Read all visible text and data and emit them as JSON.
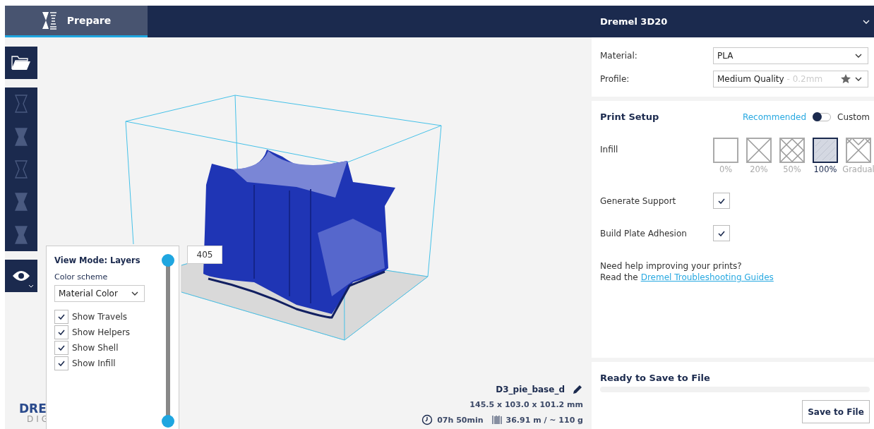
{
  "tabs": [
    {
      "label": "Prepare",
      "selected": true
    }
  ],
  "printer": {
    "name": "Dremel 3D20"
  },
  "view_popup": {
    "title": "View Mode: Layers",
    "color_scheme_label": "Color scheme",
    "color_scheme": "Material Color",
    "options": [
      {
        "label": "Show Travels",
        "checked": true
      },
      {
        "label": "Show Helpers",
        "checked": true
      },
      {
        "label": "Show Shell",
        "checked": true
      },
      {
        "label": "Show Infill",
        "checked": true
      }
    ]
  },
  "layer_slider": {
    "top_handle": {
      "level": 1,
      "reading": "405"
    },
    "bottom_handle": {
      "level": 0
    }
  },
  "logo": {
    "line_1": "DRE",
    "line_2": "DIG"
  },
  "model_info": {
    "name": "D3_pie_base_d",
    "dimensions": "145.5 x 103.0 x 101.2 mm",
    "print_time": "07h 50min",
    "material_usage": "36.91 m / ~ 110 g"
  },
  "settings": {
    "material": {
      "label": "Material:",
      "value": "PLA"
    },
    "profile": {
      "label": "Profile:",
      "value": "Medium Quality",
      "detail": "- 0.2mm"
    }
  },
  "print_setup": {
    "title": "Print Setup",
    "modes": [
      {
        "label": "Recommended",
        "selected": true
      },
      {
        "label": "Custom",
        "selected": false
      }
    ],
    "infill": {
      "label": "Infill",
      "options": [
        {
          "label": "0%",
          "kind": "empty",
          "selected": false
        },
        {
          "label": "20%",
          "kind": "sparse",
          "selected": false
        },
        {
          "label": "50%",
          "kind": "dense",
          "selected": false
        },
        {
          "label": "100%",
          "kind": "solid",
          "selected": true
        },
        {
          "label": "Gradual",
          "kind": "gradual",
          "selected": false
        }
      ]
    },
    "toggles": [
      {
        "label": "Generate Support",
        "checked": true
      },
      {
        "label": "Build Plate Adhesion",
        "checked": true
      }
    ],
    "help": {
      "text": "Need help improving your prints?",
      "link_prefix": "Read the",
      "link": "Dremel Troubleshooting Guides"
    }
  },
  "status": {
    "title": "Ready to Save to File",
    "level": 0,
    "button": "Save to File"
  }
}
